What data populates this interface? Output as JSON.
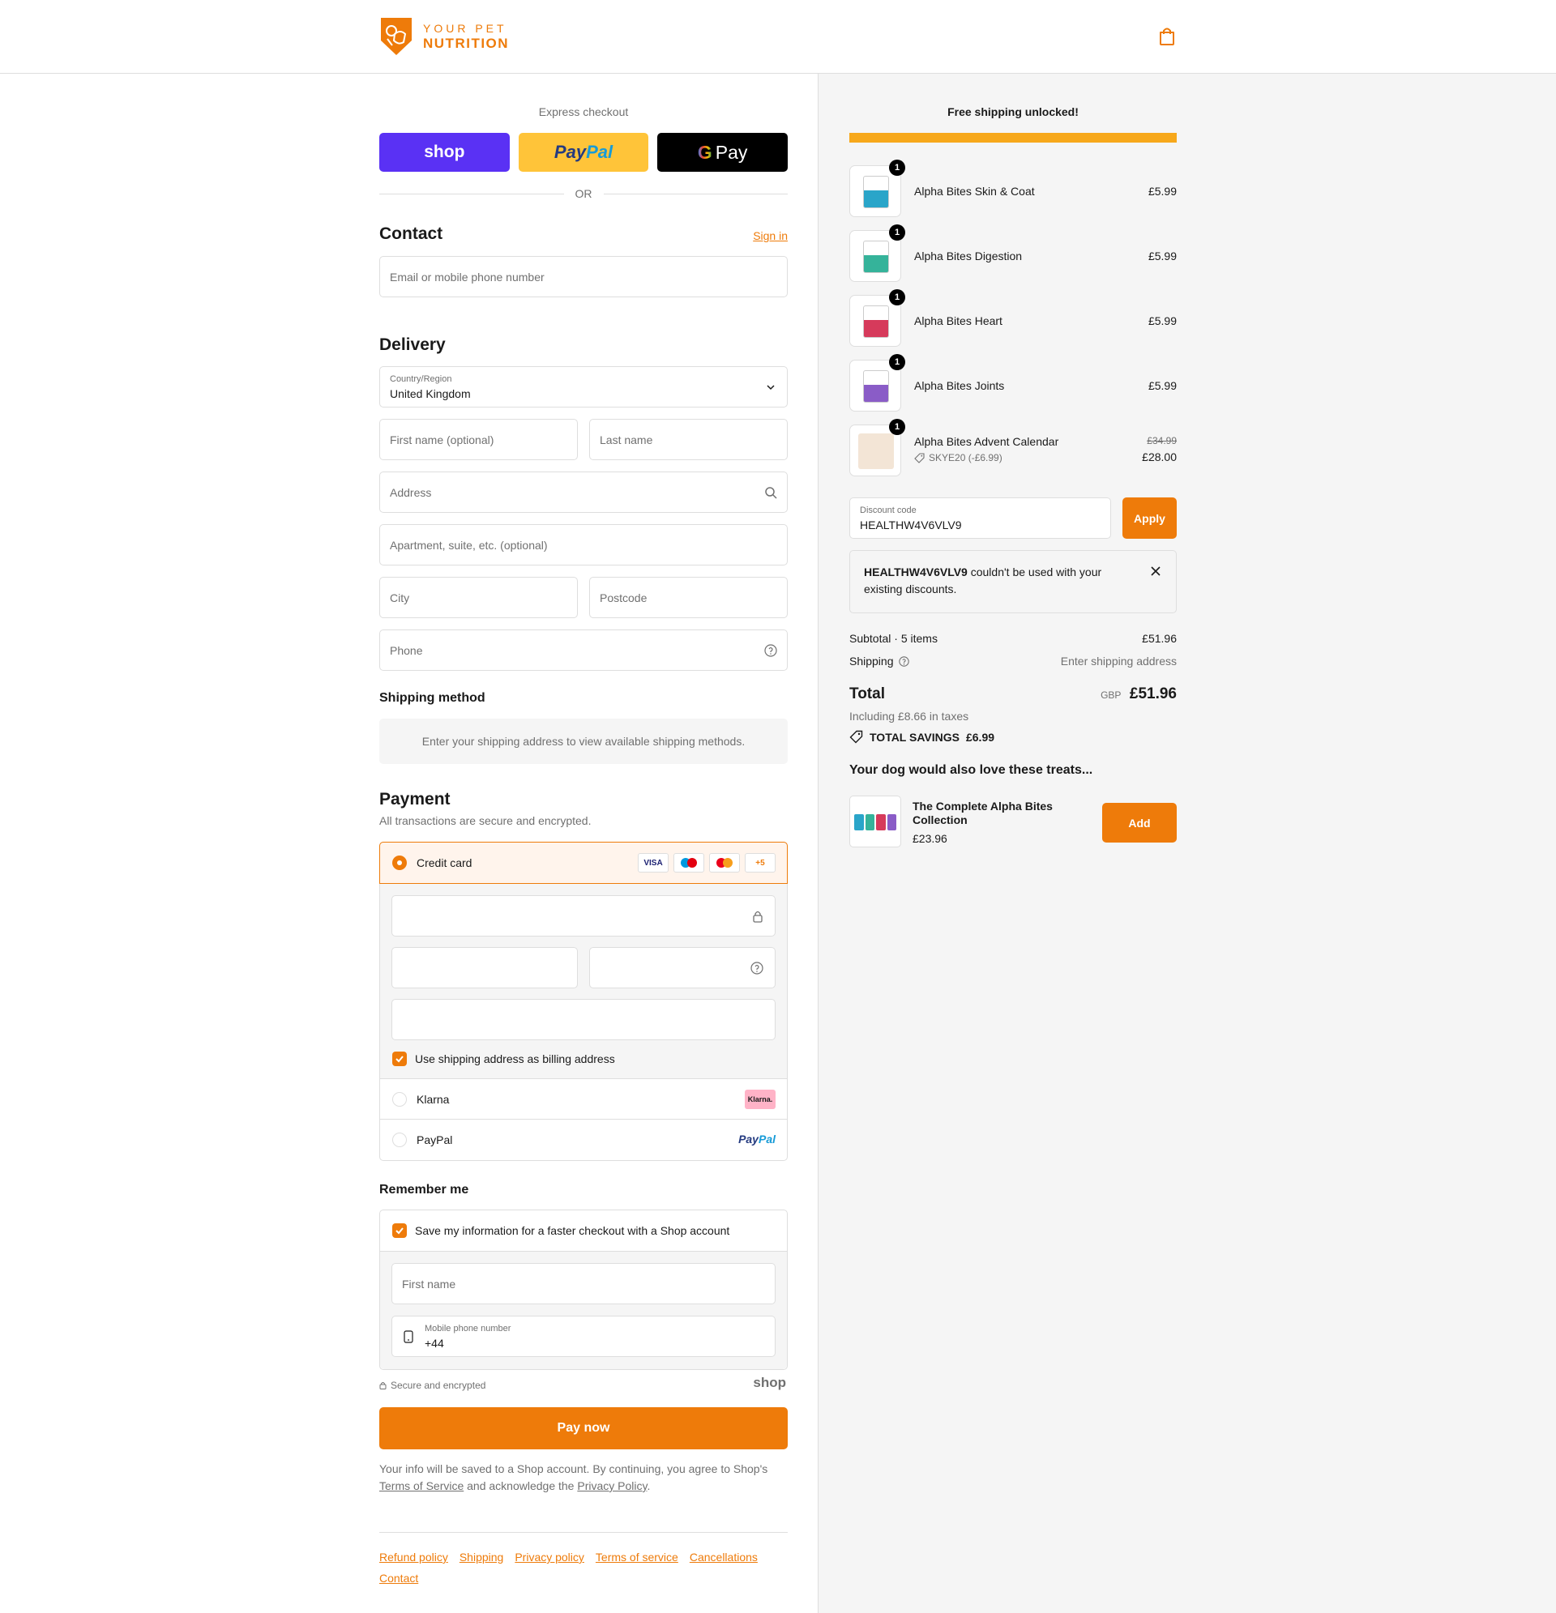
{
  "header": {
    "brand_top": "YOUR PET",
    "brand_bottom": "NUTRITION"
  },
  "express": {
    "title": "Express checkout",
    "shop_label": "shop",
    "paypal_label_1": "Pay",
    "paypal_label_2": "Pal",
    "gpay_label": "Pay",
    "or_label": "OR"
  },
  "contact": {
    "title": "Contact",
    "sign_in": "Sign in",
    "email_placeholder": "Email or mobile phone number"
  },
  "delivery": {
    "title": "Delivery",
    "country_label": "Country/Region",
    "country_value": "United Kingdom",
    "first_name": "First name (optional)",
    "last_name": "Last name",
    "address": "Address",
    "apartment": "Apartment, suite, etc. (optional)",
    "city": "City",
    "postcode": "Postcode",
    "phone": "Phone"
  },
  "shipping_method": {
    "title": "Shipping method",
    "message": "Enter your shipping address to view available shipping methods."
  },
  "payment": {
    "title": "Payment",
    "subtitle": "All transactions are secure and encrypted.",
    "credit_card": "Credit card",
    "badges": [
      "VISA",
      "",
      "",
      "+5"
    ],
    "billing_same": "Use shipping address as billing address",
    "klarna": "Klarna",
    "klarna_badge": "Klarna.",
    "paypal": "PayPal",
    "paypal_badge_1": "Pay",
    "paypal_badge_2": "Pal"
  },
  "remember": {
    "title": "Remember me",
    "save_label": "Save my information for a faster checkout with a Shop account",
    "first_name": "First name",
    "mobile_label": "Mobile phone number",
    "mobile_value": "+44"
  },
  "secure_label": "Secure and encrypted",
  "shop_mark": "shop",
  "pay_now": "Pay now",
  "legal": {
    "text_1": "Your info will be saved to a Shop account. By continuing, you agree to Shop's ",
    "tos": "Terms of Service",
    "text_2": " and acknowledge the ",
    "privacy": "Privacy Policy",
    "text_3": "."
  },
  "footer": [
    "Refund policy",
    "Shipping",
    "Privacy policy",
    "Terms of service",
    "Cancellations",
    "Contact"
  ],
  "summary": {
    "free_shipping": "Free shipping unlocked!",
    "progress": 1.0,
    "items": [
      {
        "qty": "1",
        "name": "Alpha Bites Skin & Coat",
        "price": "£5.99",
        "color": "#2aa5c9"
      },
      {
        "qty": "1",
        "name": "Alpha Bites Digestion",
        "price": "£5.99",
        "color": "#35b39a"
      },
      {
        "qty": "1",
        "name": "Alpha Bites Heart",
        "price": "£5.99",
        "color": "#d63a5b"
      },
      {
        "qty": "1",
        "name": "Alpha Bites Joints",
        "price": "£5.99",
        "color": "#8a5cc7"
      }
    ],
    "advent": {
      "qty": "1",
      "name": "Alpha Bites Advent Calendar",
      "code": "SKYE20 (-£6.99)",
      "old_price": "£34.99",
      "price": "£28.00"
    },
    "discount_label": "Discount code",
    "discount_value": "HEALTHW4V6VLV9",
    "apply": "Apply",
    "error_code": "HEALTHW4V6VLV9",
    "error_text": " couldn't be used with your existing discounts.",
    "subtotal_label": "Subtotal · 5 items",
    "subtotal_value": "£51.96",
    "shipping_label": "Shipping",
    "shipping_value": "Enter shipping address",
    "total_label": "Total",
    "currency": "GBP",
    "total_value": "£51.96",
    "taxes": "Including £8.66 in taxes",
    "savings_label": "TOTAL SAVINGS",
    "savings_value": "£6.99",
    "upsell_title": "Your dog would also love these treats...",
    "upsell_name": "The Complete Alpha Bites Collection",
    "upsell_price": "£23.96",
    "add": "Add"
  },
  "colors": {
    "accent": "#ee7b0a",
    "progress": "#f7a81b",
    "shop": "#5a31f4",
    "paypal": "#ffc439"
  }
}
